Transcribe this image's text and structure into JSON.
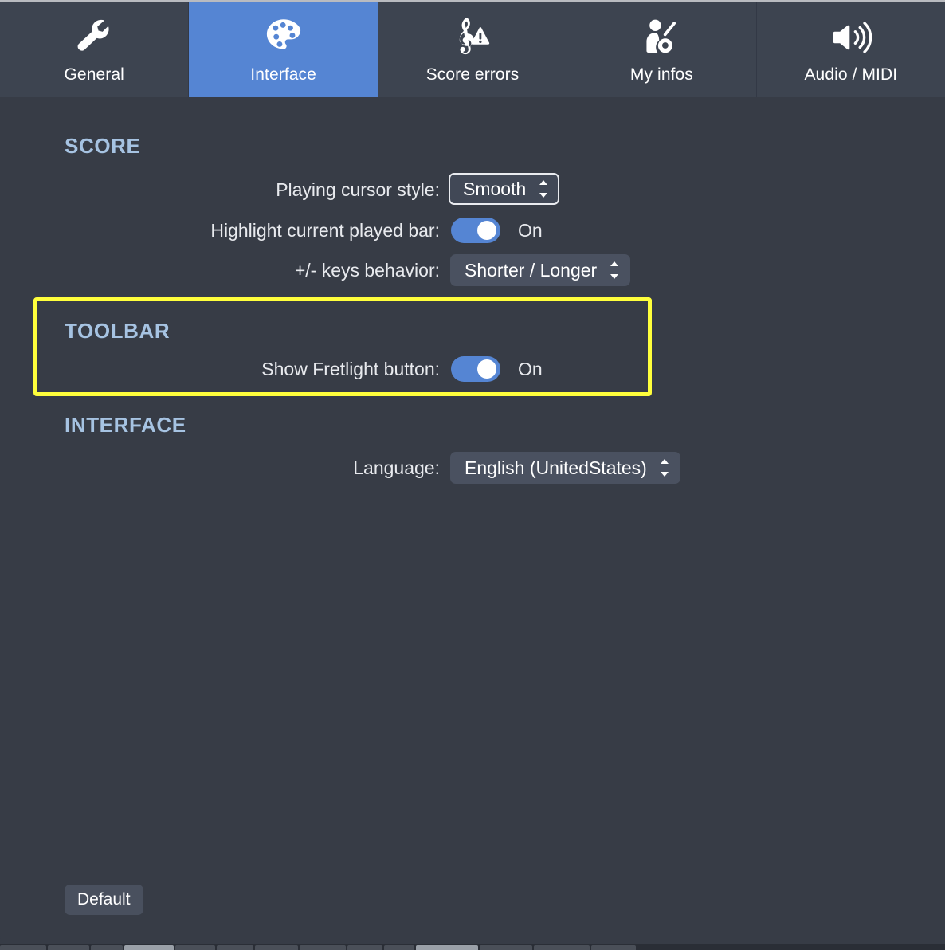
{
  "window": {
    "background_color": "#373c46",
    "accent_color": "#5585d3",
    "heading_color": "#a6c3e2",
    "highlight_color": "#ffff3c"
  },
  "tabbar": {
    "tabs": [
      {
        "id": "general",
        "label": "General",
        "icon": "wrench-icon",
        "selected": false
      },
      {
        "id": "interface",
        "label": "Interface",
        "icon": "palette-icon",
        "selected": true
      },
      {
        "id": "score-errors",
        "label": "Score errors",
        "icon": "clef-warning-icon",
        "selected": false
      },
      {
        "id": "my-infos",
        "label": "My infos",
        "icon": "guitarist-icon",
        "selected": false
      },
      {
        "id": "audio-midi",
        "label": "Audio / MIDI",
        "icon": "speaker-waves-icon",
        "selected": false
      }
    ]
  },
  "sections": {
    "score": {
      "title": "SCORE",
      "rows": {
        "cursor_style": {
          "label": "Playing cursor style:",
          "value": "Smooth",
          "control": "select",
          "focused": true
        },
        "highlight_bar": {
          "label": "Highlight current played bar:",
          "control": "toggle",
          "state": "On",
          "on": true
        },
        "keys_behavior": {
          "label": "+/- keys behavior:",
          "value": "Shorter / Longer",
          "control": "select",
          "focused": false
        }
      }
    },
    "toolbar": {
      "title": "TOOLBAR",
      "highlighted": true,
      "rows": {
        "fretlight": {
          "label": "Show Fretlight button:",
          "control": "toggle",
          "state": "On",
          "on": true
        }
      }
    },
    "interface": {
      "title": "INTERFACE",
      "rows": {
        "language": {
          "label": "Language:",
          "value": "English (UnitedStates)",
          "control": "select",
          "focused": false
        }
      }
    }
  },
  "footer": {
    "default_label": "Default"
  }
}
